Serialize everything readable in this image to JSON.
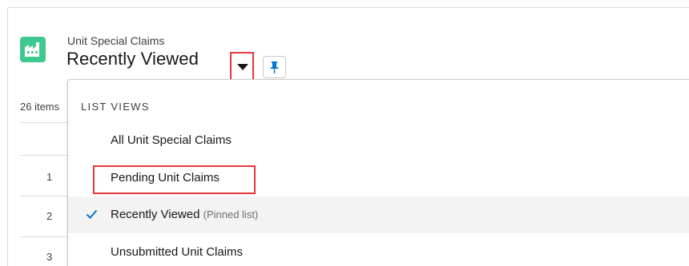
{
  "header": {
    "object_label": "Unit Special Claims",
    "list_title": "Recently Viewed"
  },
  "icons": {
    "app": "factory-icon",
    "toggle": "caret-down-icon",
    "pin": "pin-icon",
    "check": "checkmark-icon"
  },
  "colors": {
    "app_icon_bg": "#3fc98e",
    "highlight": "#e5363b",
    "check": "#0176d3",
    "pin": "#0176d3"
  },
  "list": {
    "items_count": "26 items",
    "row_numbers": [
      "1",
      "2",
      "3"
    ]
  },
  "dropdown": {
    "header": "LIST VIEWS",
    "items": [
      {
        "label": "All Unit Special Claims",
        "suffix": ""
      },
      {
        "label": "Pending Unit Claims",
        "suffix": ""
      },
      {
        "label": "Recently Viewed",
        "suffix": "(Pinned list)",
        "selected": true
      },
      {
        "label": "Unsubmitted Unit Claims",
        "suffix": ""
      }
    ]
  }
}
